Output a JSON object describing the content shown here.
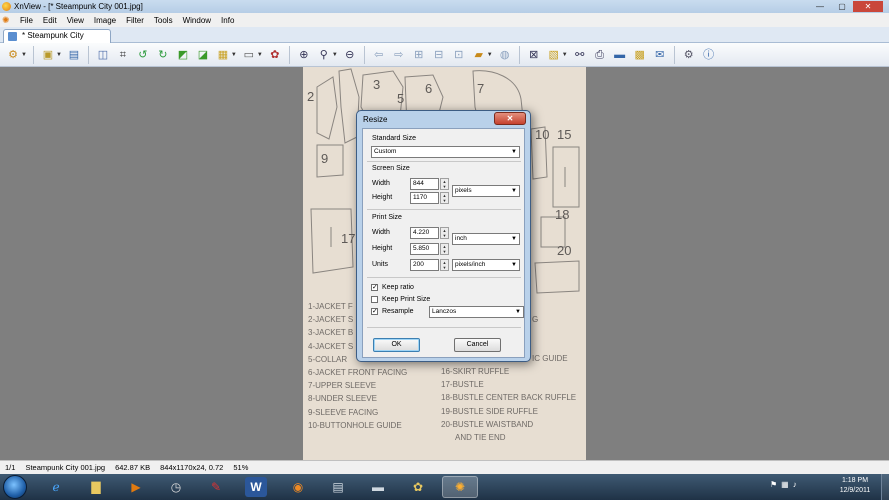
{
  "window": {
    "title": "XnView - [* Steampunk City 001.jpg]",
    "controls": [
      "—",
      "▢",
      "✕"
    ]
  },
  "menu": [
    "File",
    "Edit",
    "View",
    "Image",
    "Filter",
    "Tools",
    "Window",
    "Info"
  ],
  "tab": {
    "label": "* Steampunk City 001.jpg"
  },
  "image": {
    "piece_numbers": [
      "2",
      "3",
      "5",
      "6",
      "7",
      "10",
      "15",
      "9",
      "18",
      "17",
      "20"
    ],
    "legend_left": [
      "1-JACKET F",
      "2-JACKET S",
      "3-JACKET B",
      "4-JACKET S",
      "5-COLLAR",
      "6-JACKET FRONT FACING",
      "7-UPPER SLEEVE",
      "8-UNDER SLEEVE",
      "9-SLEEVE FACING",
      "10-BUTTONHOLE GUIDE"
    ],
    "legend_right": [
      "G",
      "IC GUIDE",
      "16-SKIRT RUFFLE",
      "17-BUSTLE",
      "18-BUSTLE CENTER BACK RUFFLE",
      "19-BUSTLE SIDE RUFFLE",
      "20-BUSTLE WAISTBAND",
      "AND TIE END"
    ]
  },
  "dialog": {
    "title": "Resize",
    "close": "✕",
    "standard_size": {
      "label": "Standard Size",
      "value": "Custom"
    },
    "screen_size": {
      "label": "Screen Size",
      "width_label": "Width",
      "width": "844",
      "height_label": "Height",
      "height": "1170",
      "unit": "pixels"
    },
    "print_size": {
      "label": "Print Size",
      "width_label": "Width",
      "width": "4.220",
      "height_label": "Height",
      "height": "5.850",
      "unit": "inch",
      "units_label": "Units",
      "units": "200",
      "units_unit": "pixels/inch"
    },
    "keep_ratio": {
      "label": "Keep ratio",
      "checked": true
    },
    "keep_print_size": {
      "label": "Keep Print Size",
      "checked": false
    },
    "resample": {
      "label": "Resample",
      "checked": true,
      "method": "Lanczos"
    },
    "ok": "OK",
    "cancel": "Cancel"
  },
  "status": {
    "index": "1/1",
    "filename": "Steampunk City 001.jpg",
    "filesize": "642.87 KB",
    "dims": "844x1170x24, 0.72",
    "zoom": "51%"
  },
  "taskbar": {
    "time": "1:18 PM",
    "date": "12/9/2011"
  }
}
